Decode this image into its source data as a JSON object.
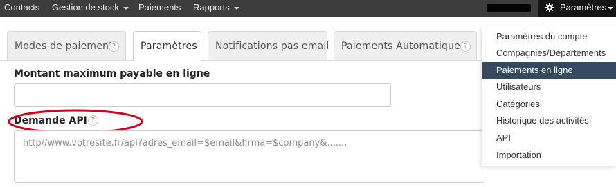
{
  "navbar": {
    "items": [
      {
        "label": "Contacts",
        "has_caret": false
      },
      {
        "label": "Gestion de stock",
        "has_caret": true
      },
      {
        "label": "Paiements",
        "has_caret": false
      },
      {
        "label": "Rapports",
        "has_caret": true
      }
    ],
    "settings": {
      "label": "Paramètres",
      "icon": "gear-icon"
    },
    "colors": {
      "bar": "#3c3c3c",
      "settings_bg": "#151515"
    }
  },
  "tabs": [
    {
      "label": "Modes de paiement",
      "has_help": true,
      "active": false
    },
    {
      "label": "Paramètres",
      "has_help": false,
      "active": true
    },
    {
      "label": "Notifications pas email",
      "has_help": false,
      "active": false
    },
    {
      "label": "Paiements Automatiques",
      "has_help": true,
      "active": false
    }
  ],
  "help_glyph": "?",
  "form": {
    "max_amount": {
      "label": "Montant maximum payable en ligne",
      "value": ""
    },
    "api_request": {
      "label": "Demande API",
      "has_help": true,
      "placeholder": "http//www.votresite.fr/api?adres_email=$email&firma=$company&......."
    }
  },
  "annotation": {
    "shape": "ellipse",
    "color": "#d0021b"
  },
  "dropdown": {
    "items": [
      {
        "label": "Paramètres du compte",
        "active": false
      },
      {
        "label": "Compagnies/Départements",
        "active": false
      },
      {
        "label": "Paiements en ligne",
        "active": true
      },
      {
        "label": "Utilisateurs",
        "active": false
      },
      {
        "label": "Catégories",
        "active": false
      },
      {
        "label": "Historique des activités",
        "active": false
      },
      {
        "label": "API",
        "active": false
      },
      {
        "label": "Importation",
        "active": false
      }
    ],
    "active_color": "#34495e"
  }
}
